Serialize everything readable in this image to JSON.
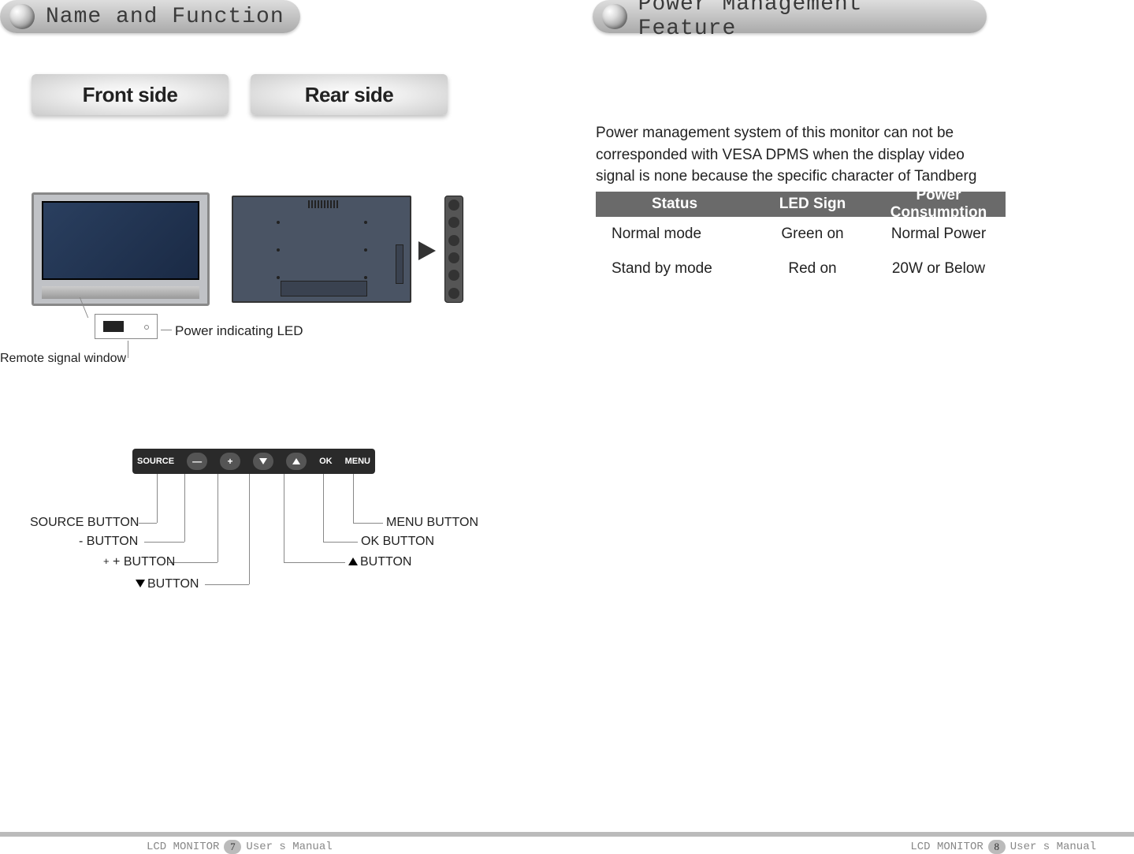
{
  "header": {
    "left": "Name and Function",
    "right": "Power Management Feature"
  },
  "tabs": {
    "front": "Front side",
    "rear": "Rear side"
  },
  "front_labels": {
    "power_led": "Power indicating LED",
    "remote_window": "Remote signal window"
  },
  "button_bar": {
    "source": "SOURCE",
    "minus": "—",
    "plus": "+",
    "ok": "OK",
    "menu": "MENU"
  },
  "button_callouts": {
    "source": "SOURCE BUTTON",
    "minus": "- BUTTON",
    "plus": "+ BUTTON",
    "down": "BUTTON",
    "up": "BUTTON",
    "ok": "OK BUTTON",
    "menu": "MENU BUTTON"
  },
  "power": {
    "paragraph": "Power management system of this monitor can not be corresponded with VESA DPMS when the display video signal is none because the specific character of Tandberg system",
    "headers": {
      "status": "Status",
      "led": "LED Sign",
      "consumption": "Power Consumption"
    },
    "rows": [
      {
        "status": "Normal mode",
        "led": "Green on",
        "consumption": "Normal Power"
      },
      {
        "status": "Stand by mode",
        "led": "Red on",
        "consumption": "20W or Below"
      }
    ]
  },
  "footer": {
    "prefix": "LCD  MONITOR",
    "suffix": "User s Manual",
    "page_left": "7",
    "page_right": "8"
  }
}
